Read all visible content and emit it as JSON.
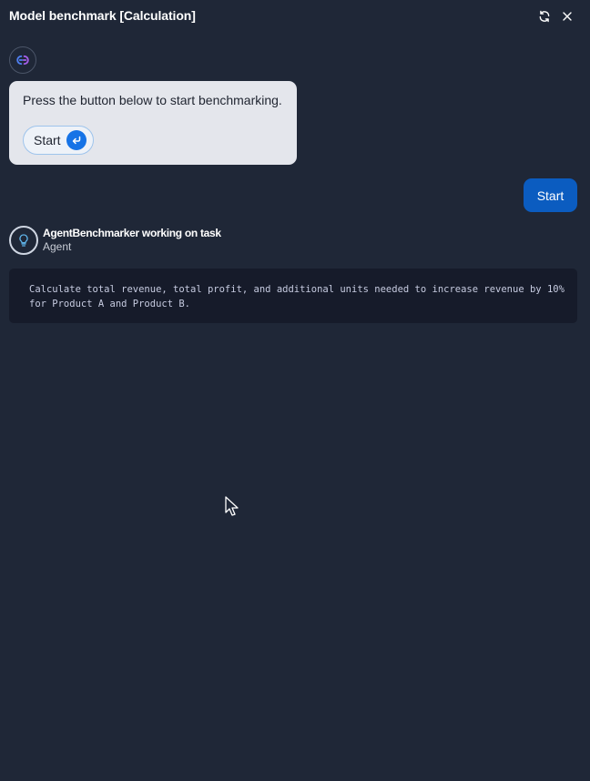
{
  "header": {
    "title": "Model benchmark [Calculation]",
    "refresh_icon": "refresh-icon",
    "close_icon": "close-icon"
  },
  "bot_message": {
    "avatar_icon": "assistant-logo-icon",
    "text": "Press the button below to start benchmarking.",
    "button_label": "Start",
    "button_icon": "enter-return-icon"
  },
  "user_message": {
    "text": "Start"
  },
  "agent": {
    "avatar_icon": "lightbulb-icon",
    "name": "AgentBenchmarker working on task",
    "role": "Agent"
  },
  "task": {
    "text": "Calculate total revenue, total profit, and additional units needed to increase revenue by 10%\nfor Product A and Product B."
  },
  "colors": {
    "background": "#1f2737",
    "bubble": "#e4e6ec",
    "user_bubble": "#0b5cc0",
    "accent": "#1673e6",
    "task_box": "#161b2a"
  }
}
